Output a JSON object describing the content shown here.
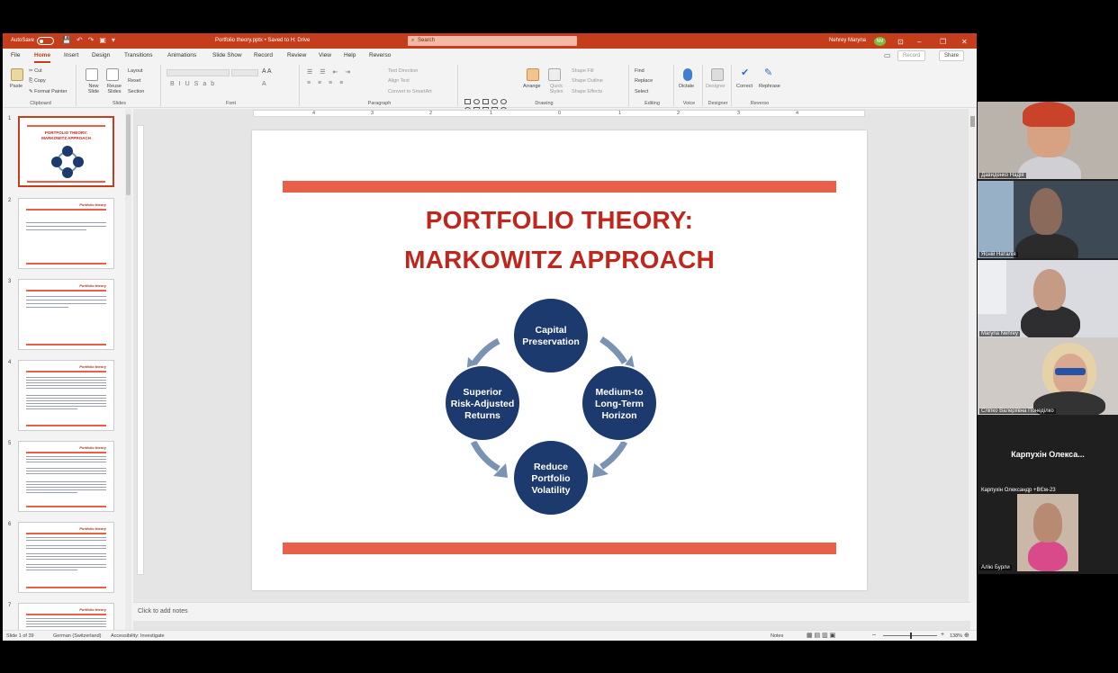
{
  "titlebar": {
    "autosave": "AutoSave",
    "autosave_state": "Off",
    "doc_title": "Portfolio theory.pptx • Saved to H: Drive",
    "search_placeholder": "Search",
    "user_name": "Nehrey Maryna",
    "user_initials": "NM"
  },
  "menu": {
    "tabs": [
      "File",
      "Home",
      "Insert",
      "Design",
      "Transitions",
      "Animations",
      "Slide Show",
      "Record",
      "Review",
      "View",
      "Help",
      "Reverso"
    ],
    "active": "Home",
    "record": "Record",
    "share": "Share"
  },
  "ribbon": {
    "clipboard": {
      "paste": "Paste",
      "cut": "Cut",
      "copy": "Copy",
      "format_painter": "Format Painter",
      "label": "Clipboard"
    },
    "slides": {
      "new_slide": "New Slide",
      "reuse": "Reuse Slides",
      "layout": "Layout",
      "reset": "Reset",
      "section": "Section",
      "label": "Slides"
    },
    "font": {
      "label": "Font"
    },
    "paragraph": {
      "text_direction": "Text Direction",
      "align_text": "Align Text",
      "convert": "Convert to SmartArt",
      "label": "Paragraph"
    },
    "drawing": {
      "arrange": "Arrange",
      "quick_styles": "Quick Styles",
      "shape_fill": "Shape Fill",
      "shape_outline": "Shape Outline",
      "shape_effects": "Shape Effects",
      "label": "Drawing"
    },
    "editing": {
      "find": "Find",
      "replace": "Replace",
      "select": "Select",
      "label": "Editing"
    },
    "voice": {
      "dictate": "Dictate",
      "label": "Voice"
    },
    "designer": {
      "designer": "Designer",
      "label": "Designer"
    },
    "reverso": {
      "correct": "Correct",
      "rephrase": "Rephrase",
      "label": "Reverso"
    }
  },
  "thumbnails": [
    {
      "num": "1",
      "title_l1": "PORTFOLIO THEORY:",
      "title_l2": "MARKOWITZ APPROACH"
    },
    {
      "num": "2",
      "header": "Portfolio theory"
    },
    {
      "num": "3",
      "header": "Portfolio theory"
    },
    {
      "num": "4",
      "header": "Portfolio theory"
    },
    {
      "num": "5",
      "header": "Portfolio theory"
    },
    {
      "num": "6",
      "header": "Portfolio theory"
    },
    {
      "num": "7",
      "header": "Portfolio theory"
    }
  ],
  "ruler": [
    "4",
    "3",
    "2",
    "1",
    "0",
    "1",
    "2",
    "3",
    "4"
  ],
  "slide": {
    "title_line1": "PORTFOLIO THEORY:",
    "title_line2": "MARKOWITZ APPROACH",
    "cycle": {
      "top": [
        "Capital",
        "Preservation"
      ],
      "right": [
        "Medium-to",
        "Long-Term",
        "Horizon"
      ],
      "bottom": [
        "Reduce",
        "Portfolio",
        "Volatility"
      ],
      "left": [
        "Superior",
        "Risk-Adjusted",
        "Returns"
      ],
      "circle_color": "#1c3a6e",
      "arrow_color": "#7b93b2"
    },
    "bar_color": "#e8604a",
    "title_color": "#c0261b"
  },
  "notes_placeholder": "Click to add notes",
  "status": {
    "slide_of": "Slide 1 of 39",
    "language": "German (Switzerland)",
    "accessibility": "Accessibility: Investigate",
    "notes": "Notes",
    "zoom": "138%"
  },
  "participants": [
    {
      "name": "Давиденко Надія"
    },
    {
      "name": "Ясній Наталія"
    },
    {
      "name": "Maryna Nehrey"
    },
    {
      "name": "Сліпко Валеріївна Понедiлко"
    },
    {
      "name": "Карпухін Олександр +ВЄм-23",
      "big_label": "Карпухін Олекса..."
    },
    {
      "name": "Алію Бурли"
    }
  ]
}
